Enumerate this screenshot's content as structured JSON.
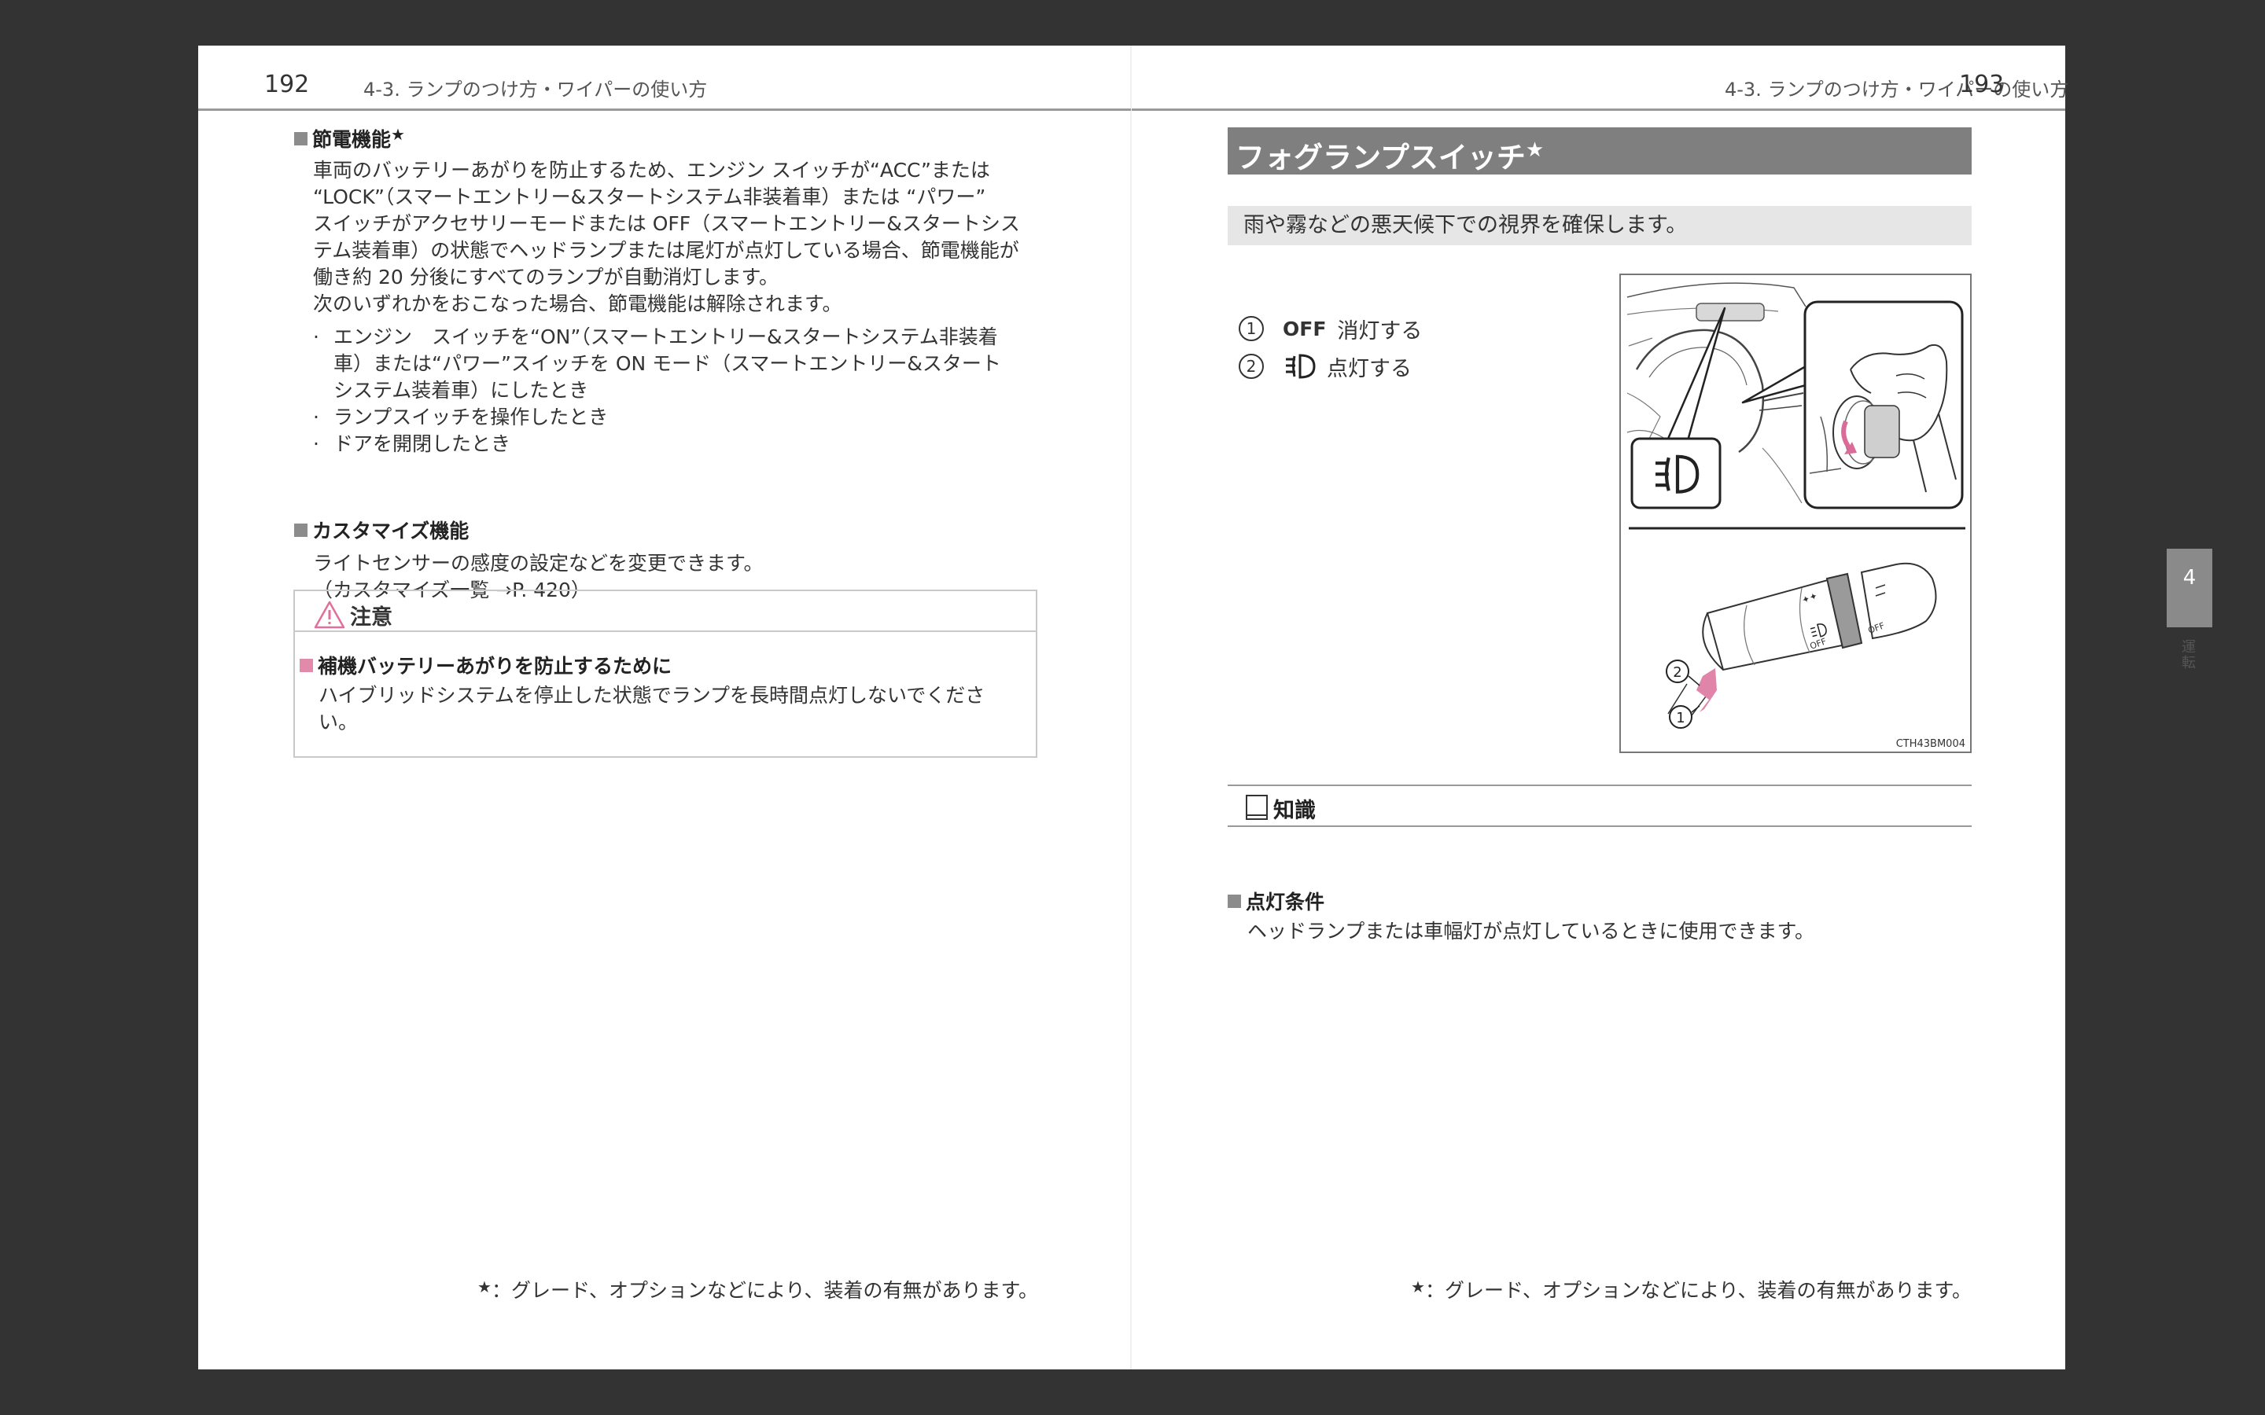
{
  "left_page": {
    "page_number": "192",
    "header": "4-3. ランプのつけ方・ワイパーの使い方",
    "power_saving": {
      "heading": "節電機能",
      "star": "★",
      "lines": [
        "車両のバッテリーあがりを防止するため、エンジン スイッチが“ACC”または",
        "“LOCK”（スマートエントリー&スタートシステム非装着車）または “パワー”",
        "スイッチがアクセサリーモードまたは OFF（スマートエントリー&スタートシス",
        "テム装着車）の状態でヘッドランプまたは尾灯が点灯している場合、節電機能が",
        "働き約 20 分後にすべてのランプが自動消灯します。",
        "次のいずれかをおこなった場合、節電機能は解除されます。"
      ],
      "bullets": [
        {
          "dot": "·",
          "text": "エンジン　スイッチを“ON”（スマートエントリー&スタートシステム非装着"
        },
        {
          "dot": "",
          "text": "車）または“パワー”スイッチを ON モード（スマートエントリー&スタート"
        },
        {
          "dot": "",
          "text": "システム装着車）にしたとき"
        },
        {
          "dot": "·",
          "text": "ランプスイッチを操作したとき"
        },
        {
          "dot": "·",
          "text": "ドアを開閉したとき"
        }
      ]
    },
    "customize": {
      "heading": "カスタマイズ機能",
      "lines": [
        "ライトセンサーの感度の設定などを変更できます。",
        "（カスタマイズ一覧 →P. 420）"
      ]
    },
    "caution": {
      "title": "注意",
      "subheading": "補機バッテリーあがりを防止するために",
      "lines": [
        "ハイブリッドシステムを停止した状態でランプを長時間点灯しないでくださ",
        "い。"
      ]
    },
    "footnote_star": "★",
    "footnote": "：グレード、オプションなどにより、装着の有無があります。"
  },
  "right_page": {
    "page_number": "193",
    "header": "4-3. ランプのつけ方・ワイパーの使い方",
    "title": "フォグランプスイッチ",
    "title_star": "★",
    "intro": "雨や霧などの悪天候下での視界を確保します。",
    "options": [
      {
        "num": "1",
        "label": "OFF",
        "text": "消灯する"
      },
      {
        "num": "2",
        "label": "",
        "text": "点灯する"
      }
    ],
    "figure": {
      "callout_1": "1",
      "callout_2": "2",
      "lever_off_1": "OFF",
      "lever_off_2": "OFF",
      "code": "CTH43BM004"
    },
    "knowledge": {
      "title": "知識",
      "subheading": "点灯条件",
      "text": "ヘッドランプまたは車幅灯が点灯しているときに使用できます。"
    },
    "side_tab": {
      "number": "4",
      "label": "運転"
    },
    "footnote_star": "★",
    "footnote": "：グレード、オプションなどにより、装着の有無があります。"
  }
}
